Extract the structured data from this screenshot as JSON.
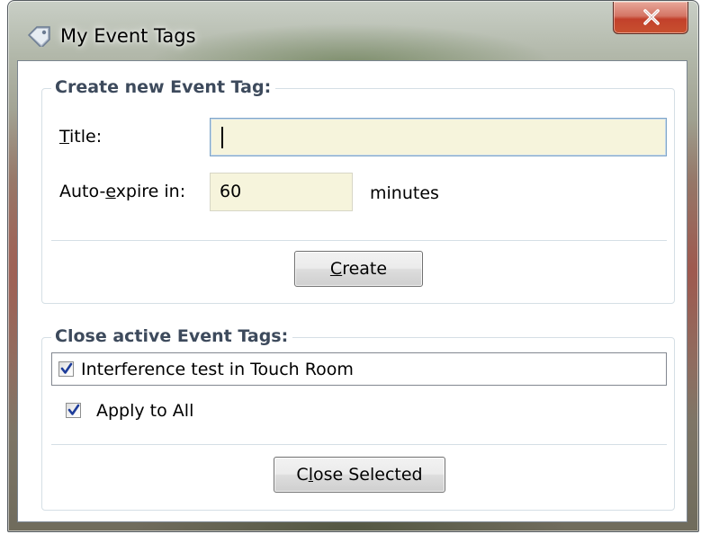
{
  "window": {
    "title": "My Event Tags",
    "app_icon": "tag-icon",
    "close_icon": "close-icon"
  },
  "create_group": {
    "legend": "Create new Event Tag:",
    "title_label": {
      "access_key": "T",
      "rest": "itle:"
    },
    "title_value": "",
    "expire_label": {
      "before": "Auto-",
      "access_key": "e",
      "after": "xpire in:"
    },
    "expire_value": "60",
    "expire_unit": "minutes",
    "create_button": {
      "access_key": "C",
      "rest": "reate"
    }
  },
  "close_group": {
    "legend": "Close active Event Tags:",
    "tags": [
      {
        "label": "Interference test in Touch Room",
        "checked": true
      }
    ],
    "apply_all": {
      "label": "Apply to All",
      "checked": true
    },
    "close_button": {
      "before": "C",
      "access_key": "l",
      "after": "ose Selected"
    }
  },
  "colors": {
    "input_background": "#f6f4dc",
    "group_border": "#d5dfe5",
    "legend_text": "#3d4a5c",
    "close_button_red": "#c8512f",
    "focus_border": "#7fa5c8",
    "checkmark": "#1e3d9a"
  }
}
